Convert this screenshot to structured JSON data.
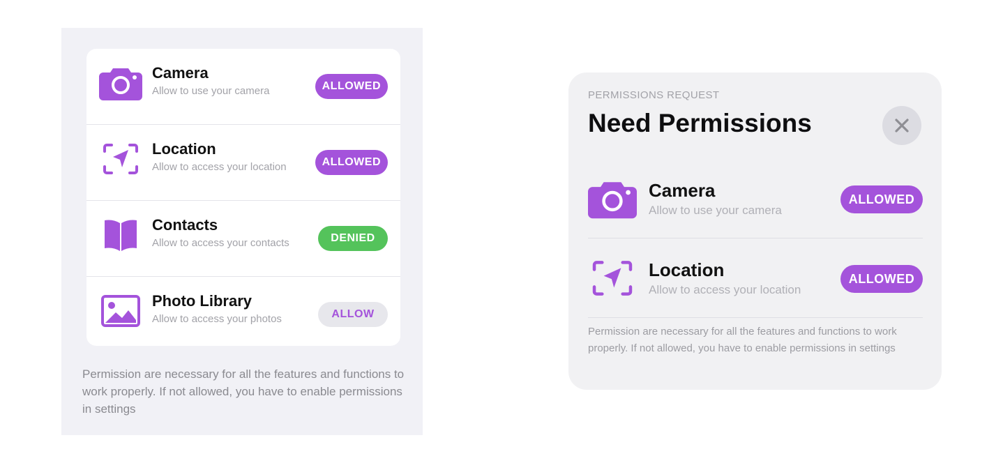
{
  "colors": {
    "accent": "#a453db",
    "denied": "#54c35b",
    "allow_bg": "#e7e7ec"
  },
  "list": {
    "items": [
      {
        "icon": "camera-icon",
        "title": "Camera",
        "subtitle": "Allow to use your camera",
        "status": "ALLOWED"
      },
      {
        "icon": "location-icon",
        "title": "Location",
        "subtitle": "Allow to access your location",
        "status": "ALLOWED"
      },
      {
        "icon": "contacts-book-icon",
        "title": "Contacts",
        "subtitle": "Allow to access your contacts",
        "status": "DENIED"
      },
      {
        "icon": "photo-library-icon",
        "title": "Photo Library",
        "subtitle": "Allow to access your photos",
        "status": "ALLOW"
      }
    ],
    "footnote": "Permission are necessary for all the features and functions to work properly. If not allowed, you have to enable permissions in settings"
  },
  "modal": {
    "eyebrow": "PERMISSIONS REQUEST",
    "title": "Need Permissions",
    "close_icon": "close-icon",
    "items": [
      {
        "icon": "camera-icon",
        "title": "Camera",
        "subtitle": "Allow to use your camera",
        "status": "ALLOWED"
      },
      {
        "icon": "location-icon",
        "title": "Location",
        "subtitle": "Allow to access your location",
        "status": "ALLOWED"
      }
    ],
    "footnote": "Permission are necessary for all the features and functions to work properly. If not allowed, you have to enable permissions in settings"
  }
}
